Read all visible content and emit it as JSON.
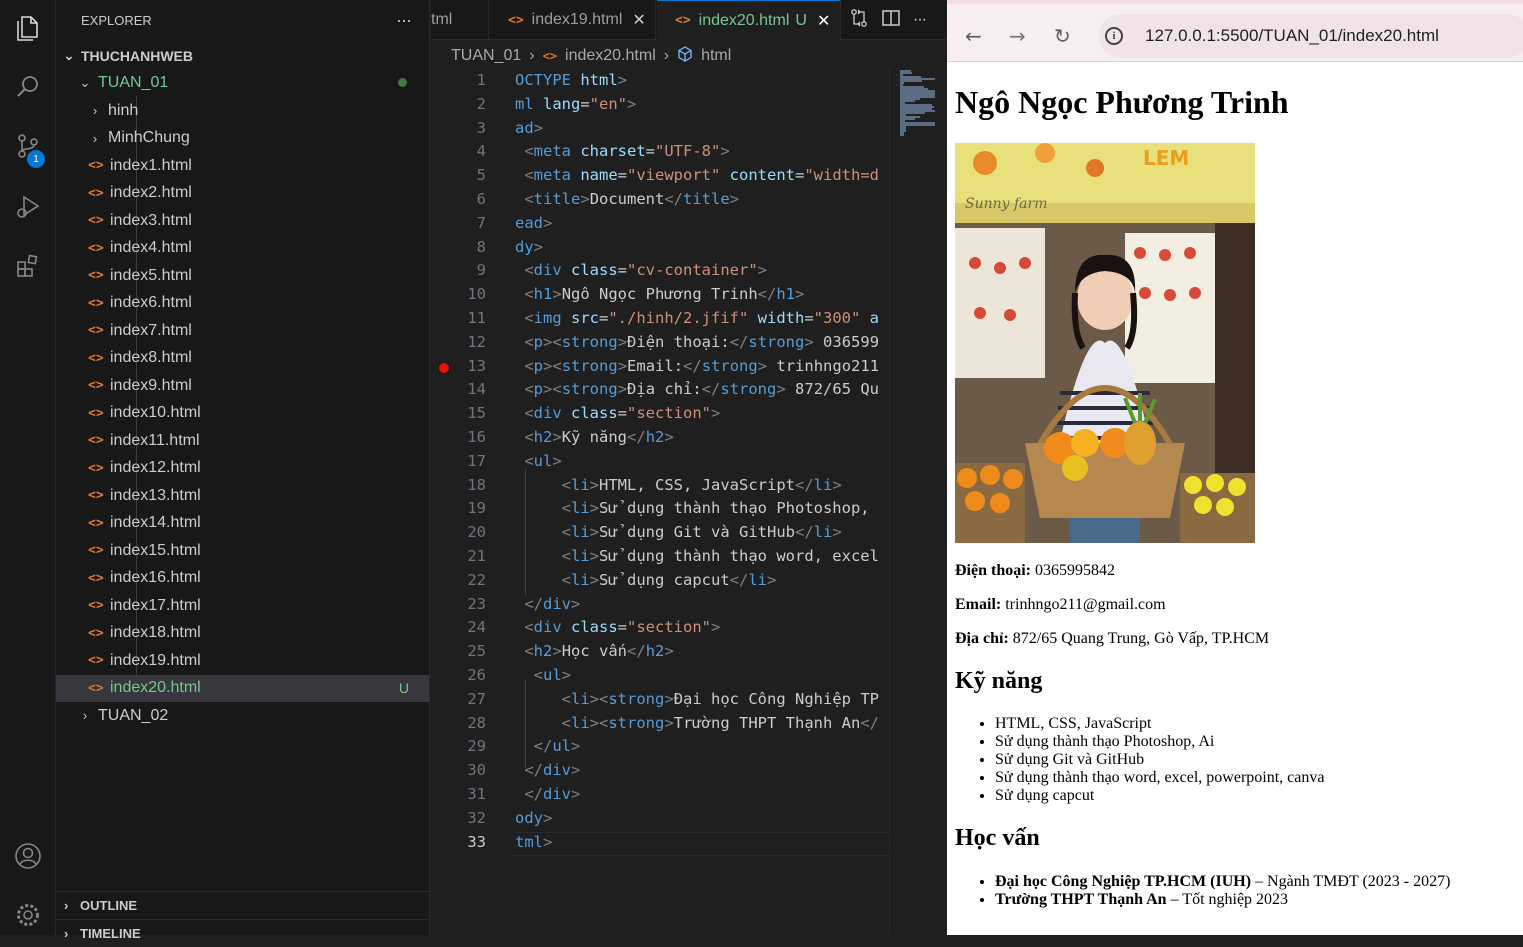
{
  "activity_bar": {
    "scm_badge": "1"
  },
  "explorer": {
    "title": "EXPLORER",
    "more": "···",
    "workspace": "THUCHANHWEB",
    "folder": "TUAN_01",
    "subfolders": [
      "hinh",
      "MinhChung"
    ],
    "files": [
      "index1.html",
      "index2.html",
      "index3.html",
      "index4.html",
      "index5.html",
      "index6.html",
      "index7.html",
      "index8.html",
      "index9.html",
      "index10.html",
      "index11.html",
      "index12.html",
      "index13.html",
      "index14.html",
      "index15.html",
      "index16.html",
      "index17.html",
      "index18.html",
      "index19.html",
      "index20.html"
    ],
    "selected_file_status": "U",
    "folder2": "TUAN_02",
    "outline": "OUTLINE",
    "timeline": "TIMELINE"
  },
  "tabs": {
    "partial": "tml",
    "tab1": "index19.html",
    "tab2": "index20.html",
    "tab2_status": "U"
  },
  "breadcrumb": {
    "folder": "TUAN_01",
    "file": "index20.html",
    "symbol": "html"
  },
  "code": {
    "line_numbers": [
      "1",
      "2",
      "3",
      "4",
      "5",
      "6",
      "7",
      "8",
      "9",
      "10",
      "11",
      "12",
      "13",
      "14",
      "15",
      "16",
      "17",
      "18",
      "19",
      "20",
      "21",
      "22",
      "23",
      "24",
      "25",
      "26",
      "27",
      "28",
      "29",
      "30",
      "31",
      "32",
      "33"
    ],
    "breakpoint_line": "13",
    "lines": [
      [
        [
          "tg",
          "OCTYPE "
        ],
        [
          "at",
          "html"
        ],
        [
          "tb",
          ">"
        ]
      ],
      [
        [
          "tg",
          "ml "
        ],
        [
          "at",
          "lang"
        ],
        [
          "",
          "="
        ],
        [
          "sv",
          "\"en\""
        ],
        [
          "tb",
          ">"
        ]
      ],
      [
        [
          "tg",
          "ad"
        ],
        [
          "tb",
          ">"
        ]
      ],
      [
        [
          "tb",
          " <"
        ],
        [
          "tg",
          "meta "
        ],
        [
          "at",
          "charset"
        ],
        [
          "",
          "="
        ],
        [
          "sv",
          "\"UTF-8\""
        ],
        [
          "tb",
          ">"
        ]
      ],
      [
        [
          "tb",
          " <"
        ],
        [
          "tg",
          "meta "
        ],
        [
          "at",
          "name"
        ],
        [
          "",
          "="
        ],
        [
          "sv",
          "\"viewport\" "
        ],
        [
          "at",
          "content"
        ],
        [
          "",
          "="
        ],
        [
          "sv",
          "\"width=d"
        ]
      ],
      [
        [
          "tb",
          " <"
        ],
        [
          "tg",
          "title"
        ],
        [
          "tb",
          ">"
        ],
        [
          "",
          "Document"
        ],
        [
          "tb",
          "</"
        ],
        [
          "tg",
          "title"
        ],
        [
          "tb",
          ">"
        ]
      ],
      [
        [
          "tg",
          "ead"
        ],
        [
          "tb",
          ">"
        ]
      ],
      [
        [
          "tg",
          "dy"
        ],
        [
          "tb",
          ">"
        ]
      ],
      [
        [
          "tb",
          " <"
        ],
        [
          "tg",
          "div "
        ],
        [
          "at",
          "class"
        ],
        [
          "",
          "="
        ],
        [
          "sv",
          "\"cv-container\""
        ],
        [
          "tb",
          ">"
        ]
      ],
      [
        [
          "tb",
          " <"
        ],
        [
          "tg",
          "h1"
        ],
        [
          "tb",
          ">"
        ],
        [
          "",
          "Ngô Ngọc Phương Trinh"
        ],
        [
          "tb",
          "</"
        ],
        [
          "tg",
          "h1"
        ],
        [
          "tb",
          ">"
        ]
      ],
      [
        [
          "tb",
          " <"
        ],
        [
          "tg",
          "img "
        ],
        [
          "at",
          "src"
        ],
        [
          "",
          "="
        ],
        [
          "sv",
          "\"./hinh/2.jfif\" "
        ],
        [
          "at",
          "width"
        ],
        [
          "",
          "="
        ],
        [
          "sv",
          "\"300\" "
        ],
        [
          "at",
          "a"
        ]
      ],
      [
        [
          "tb",
          " <"
        ],
        [
          "tg",
          "p"
        ],
        [
          "tb",
          "><"
        ],
        [
          "tg",
          "strong"
        ],
        [
          "tb",
          ">"
        ],
        [
          "",
          "Điện thoại:"
        ],
        [
          "tb",
          "</"
        ],
        [
          "tg",
          "strong"
        ],
        [
          "tb",
          "> "
        ],
        [
          "",
          "036599"
        ]
      ],
      [
        [
          "tb",
          " <"
        ],
        [
          "tg",
          "p"
        ],
        [
          "tb",
          "><"
        ],
        [
          "tg",
          "strong"
        ],
        [
          "tb",
          ">"
        ],
        [
          "",
          "Email:"
        ],
        [
          "tb",
          "</"
        ],
        [
          "tg",
          "strong"
        ],
        [
          "tb",
          "> "
        ],
        [
          "",
          "trinhngo211"
        ]
      ],
      [
        [
          "tb",
          " <"
        ],
        [
          "tg",
          "p"
        ],
        [
          "tb",
          "><"
        ],
        [
          "tg",
          "strong"
        ],
        [
          "tb",
          ">"
        ],
        [
          "",
          "Địa chỉ:"
        ],
        [
          "tb",
          "</"
        ],
        [
          "tg",
          "strong"
        ],
        [
          "tb",
          "> "
        ],
        [
          "",
          "872/65 Qu"
        ]
      ],
      [
        [
          "tb",
          " <"
        ],
        [
          "tg",
          "div "
        ],
        [
          "at",
          "class"
        ],
        [
          "",
          "="
        ],
        [
          "sv",
          "\"section\""
        ],
        [
          "tb",
          ">"
        ]
      ],
      [
        [
          "tb",
          " <"
        ],
        [
          "tg",
          "h2"
        ],
        [
          "tb",
          ">"
        ],
        [
          "",
          "Kỹ năng"
        ],
        [
          "tb",
          "</"
        ],
        [
          "tg",
          "h2"
        ],
        [
          "tb",
          ">"
        ]
      ],
      [
        [
          "tb",
          " <"
        ],
        [
          "tg",
          "ul"
        ],
        [
          "tb",
          ">"
        ]
      ],
      [
        [
          "tb",
          "     <"
        ],
        [
          "tg",
          "li"
        ],
        [
          "tb",
          ">"
        ],
        [
          "",
          "HTML, CSS, JavaScript"
        ],
        [
          "tb",
          "</"
        ],
        [
          "tg",
          "li"
        ],
        [
          "tb",
          ">"
        ]
      ],
      [
        [
          "tb",
          "     <"
        ],
        [
          "tg",
          "li"
        ],
        [
          "tb",
          ">"
        ],
        [
          "",
          "Sử dụng thành thạo Photoshop,"
        ]
      ],
      [
        [
          "tb",
          "     <"
        ],
        [
          "tg",
          "li"
        ],
        [
          "tb",
          ">"
        ],
        [
          "",
          "Sử dụng Git và GitHub"
        ],
        [
          "tb",
          "</"
        ],
        [
          "tg",
          "li"
        ],
        [
          "tb",
          ">"
        ]
      ],
      [
        [
          "tb",
          "     <"
        ],
        [
          "tg",
          "li"
        ],
        [
          "tb",
          ">"
        ],
        [
          "",
          "Sử dụng thành thạo word, excel"
        ]
      ],
      [
        [
          "tb",
          "     <"
        ],
        [
          "tg",
          "li"
        ],
        [
          "tb",
          ">"
        ],
        [
          "",
          "Sử dụng capcut"
        ],
        [
          "tb",
          "</"
        ],
        [
          "tg",
          "li"
        ],
        [
          "tb",
          ">"
        ]
      ],
      [
        [
          "tb",
          " </"
        ],
        [
          "tg",
          "div"
        ],
        [
          "tb",
          ">"
        ]
      ],
      [
        [
          "tb",
          " <"
        ],
        [
          "tg",
          "div "
        ],
        [
          "at",
          "class"
        ],
        [
          "",
          "="
        ],
        [
          "sv",
          "\"section\""
        ],
        [
          "tb",
          ">"
        ]
      ],
      [
        [
          "tb",
          " <"
        ],
        [
          "tg",
          "h2"
        ],
        [
          "tb",
          ">"
        ],
        [
          "",
          "Học vấn"
        ],
        [
          "tb",
          "</"
        ],
        [
          "tg",
          "h2"
        ],
        [
          "tb",
          ">"
        ]
      ],
      [
        [
          "tb",
          "  <"
        ],
        [
          "tg",
          "ul"
        ],
        [
          "tb",
          ">"
        ]
      ],
      [
        [
          "tb",
          "     <"
        ],
        [
          "tg",
          "li"
        ],
        [
          "tb",
          "><"
        ],
        [
          "tg",
          "strong"
        ],
        [
          "tb",
          ">"
        ],
        [
          "",
          "Đại học Công Nghiệp TP"
        ]
      ],
      [
        [
          "tb",
          "     <"
        ],
        [
          "tg",
          "li"
        ],
        [
          "tb",
          "><"
        ],
        [
          "tg",
          "strong"
        ],
        [
          "tb",
          ">"
        ],
        [
          "",
          "Trường THPT Thạnh An"
        ],
        [
          "tb",
          "</"
        ]
      ],
      [
        [
          "tb",
          "  </"
        ],
        [
          "tg",
          "ul"
        ],
        [
          "tb",
          ">"
        ]
      ],
      [
        [
          "tb",
          " </"
        ],
        [
          "tg",
          "div"
        ],
        [
          "tb",
          ">"
        ]
      ],
      [
        [
          "tb",
          " </"
        ],
        [
          "tg",
          "div"
        ],
        [
          "tb",
          ">"
        ]
      ],
      [
        [
          "tg",
          "ody"
        ],
        [
          "tb",
          ">"
        ]
      ],
      [
        [
          "tg",
          "tml"
        ],
        [
          "tb",
          ">"
        ]
      ]
    ]
  },
  "browser": {
    "url": "127.0.0.1:5500/TUAN_01/index20.html",
    "name": "Ngô Ngọc Phương Trinh",
    "photo_sign": "LEM",
    "photo_script": "Sunny farm",
    "phone_label": "Điện thoại:",
    "phone": " 0365995842",
    "email_label": "Email:",
    "email": " trinhngo211@gmail.com",
    "address_label": "Địa chỉ:",
    "address": " 872/65 Quang Trung, Gò Vấp, TP.HCM",
    "skills_title": "Kỹ năng",
    "skills": [
      "HTML, CSS, JavaScript",
      "Sử dụng thành thạo Photoshop, Ai",
      "Sử dụng Git và GitHub",
      "Sử dụng thành thạo word, excel, powerpoint, canva",
      "Sử dụng capcut"
    ],
    "edu_title": "Học vấn",
    "edu": [
      {
        "school": "Đại học Công Nghiệp TP.HCM (IUH)",
        "detail": " – Ngành TMĐT (2023 - 2027)"
      },
      {
        "school": "Trường THPT Thạnh An",
        "detail": " – Tốt nghiệp 2023"
      }
    ]
  }
}
